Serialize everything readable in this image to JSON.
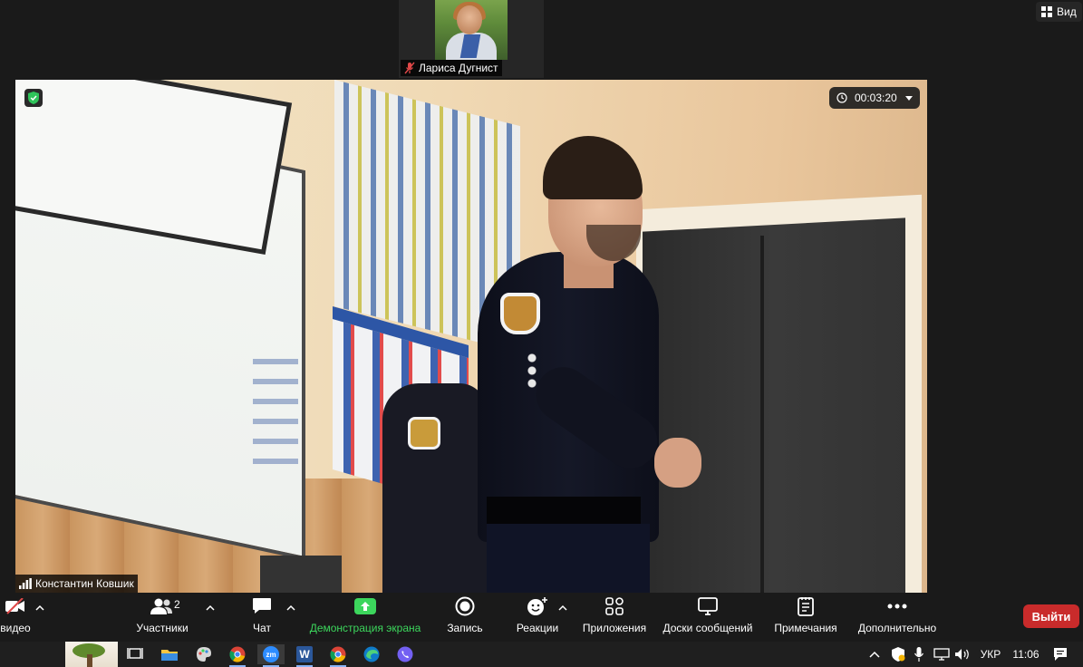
{
  "thumbnail": {
    "participant_name": "Лариса Дугнист",
    "mic_muted": true
  },
  "view_button": {
    "label": "Вид"
  },
  "main_video": {
    "timer": "00:03:20",
    "speaker_name": "Константин Ковшик"
  },
  "toolbar": {
    "video_label": "видео",
    "participants_label": "Участники",
    "participants_count": "2",
    "chat_label": "Чат",
    "share_screen_label": "Демонстрация экрана",
    "record_label": "Запись",
    "reactions_label": "Реакции",
    "apps_label": "Приложения",
    "whiteboards_label": "Доски сообщений",
    "notes_label": "Примечания",
    "more_label": "Дополнительно",
    "leave_label": "Выйти"
  },
  "taskbar": {
    "apps": [
      "task-view",
      "file-explorer",
      "paint",
      "chrome",
      "zoom",
      "word",
      "chrome-2",
      "edge",
      "viber"
    ],
    "zoom_app_text": "zm",
    "word_app_text": "W",
    "language": "УКР",
    "clock": "11:06"
  },
  "colors": {
    "accent_green": "#3cd65c",
    "leave_red": "#c92b2b",
    "toolbar_bg": "#1a1a1a",
    "taskbar_bg": "#1f1f1f"
  }
}
